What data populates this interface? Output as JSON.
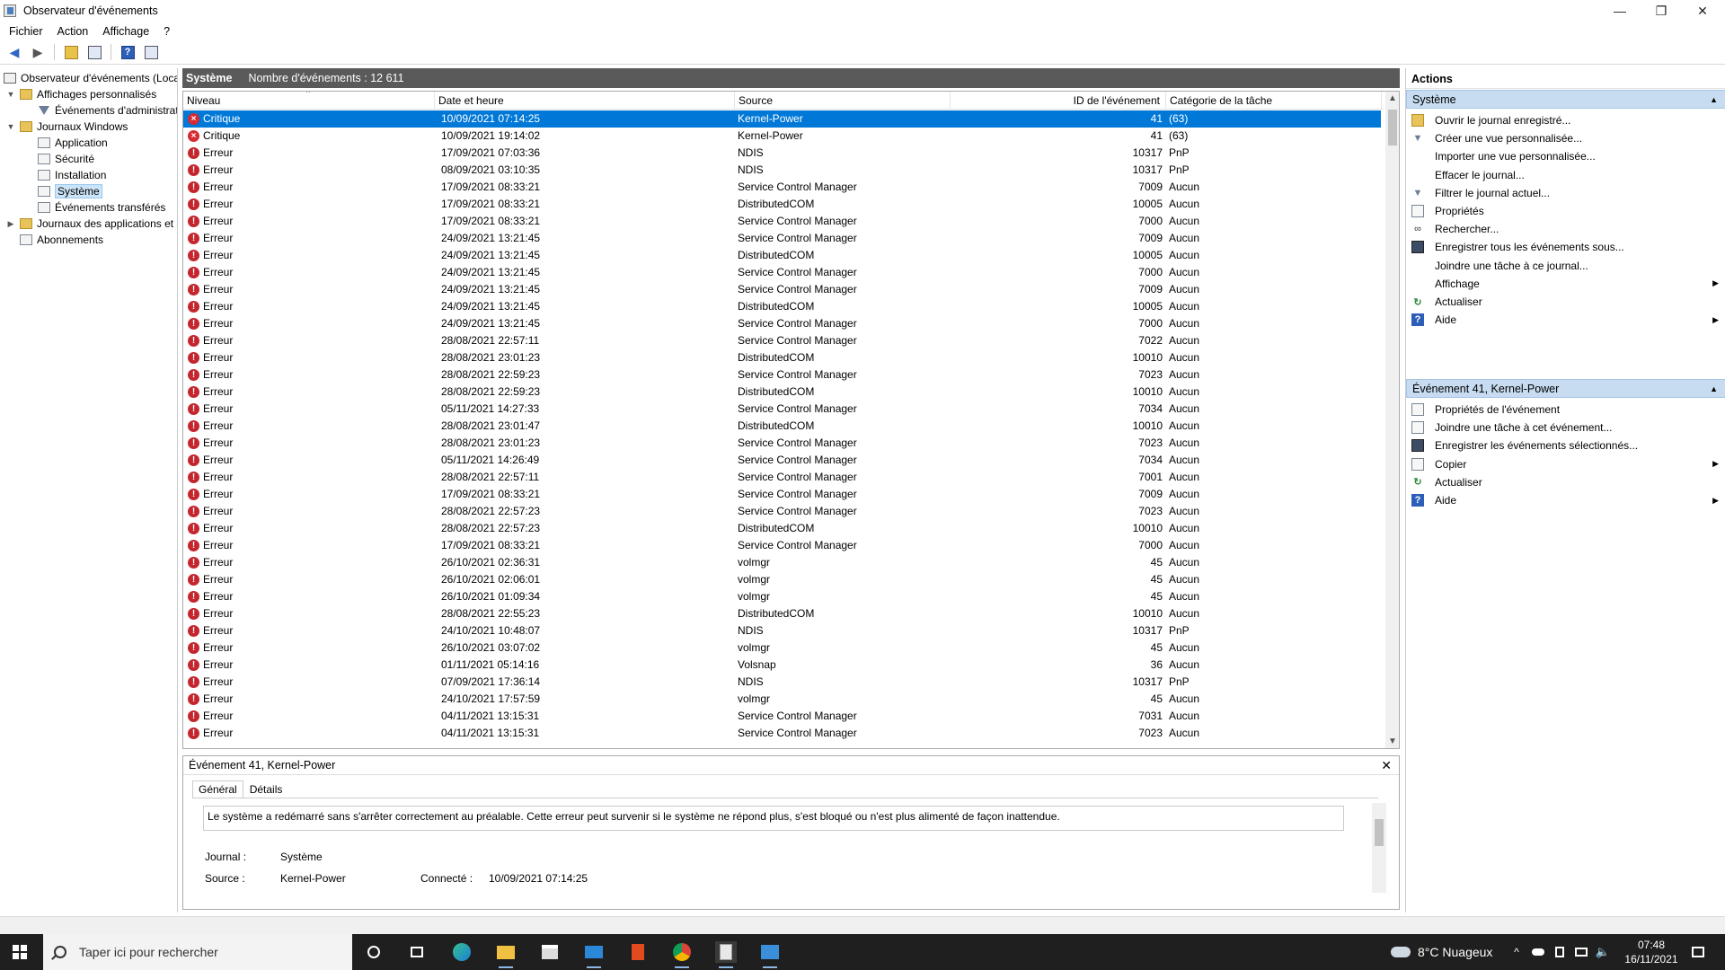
{
  "window": {
    "title": "Observateur d'événements",
    "min": "—",
    "max": "❐",
    "close": "✕"
  },
  "menu": [
    "Fichier",
    "Action",
    "Affichage",
    "?"
  ],
  "tree": {
    "root": "Observateur d'événements (Local)",
    "custom_views": "Affichages personnalisés",
    "admin_events": "Événements d'administration",
    "windows_logs": "Journaux Windows",
    "application": "Application",
    "security": "Sécurité",
    "setup": "Installation",
    "system": "Système",
    "forwarded": "Événements transférés",
    "apps_logs": "Journaux des applications et services",
    "subscriptions": "Abonnements"
  },
  "list_header": {
    "title": "Système",
    "count": "Nombre d'événements : 12 611"
  },
  "columns": [
    "Niveau",
    "Date et heure",
    "Source",
    "ID de l'événement",
    "Catégorie de la tâche"
  ],
  "events": [
    [
      "Critique",
      "10/09/2021 07:14:25",
      "Kernel-Power",
      "41",
      "(63)"
    ],
    [
      "Critique",
      "10/09/2021 19:14:02",
      "Kernel-Power",
      "41",
      "(63)"
    ],
    [
      "Erreur",
      "17/09/2021 07:03:36",
      "NDIS",
      "10317",
      "PnP"
    ],
    [
      "Erreur",
      "08/09/2021 03:10:35",
      "NDIS",
      "10317",
      "PnP"
    ],
    [
      "Erreur",
      "17/09/2021 08:33:21",
      "Service Control Manager",
      "7009",
      "Aucun"
    ],
    [
      "Erreur",
      "17/09/2021 08:33:21",
      "DistributedCOM",
      "10005",
      "Aucun"
    ],
    [
      "Erreur",
      "17/09/2021 08:33:21",
      "Service Control Manager",
      "7000",
      "Aucun"
    ],
    [
      "Erreur",
      "24/09/2021 13:21:45",
      "Service Control Manager",
      "7009",
      "Aucun"
    ],
    [
      "Erreur",
      "24/09/2021 13:21:45",
      "DistributedCOM",
      "10005",
      "Aucun"
    ],
    [
      "Erreur",
      "24/09/2021 13:21:45",
      "Service Control Manager",
      "7000",
      "Aucun"
    ],
    [
      "Erreur",
      "24/09/2021 13:21:45",
      "Service Control Manager",
      "7009",
      "Aucun"
    ],
    [
      "Erreur",
      "24/09/2021 13:21:45",
      "DistributedCOM",
      "10005",
      "Aucun"
    ],
    [
      "Erreur",
      "24/09/2021 13:21:45",
      "Service Control Manager",
      "7000",
      "Aucun"
    ],
    [
      "Erreur",
      "28/08/2021 22:57:11",
      "Service Control Manager",
      "7022",
      "Aucun"
    ],
    [
      "Erreur",
      "28/08/2021 23:01:23",
      "DistributedCOM",
      "10010",
      "Aucun"
    ],
    [
      "Erreur",
      "28/08/2021 22:59:23",
      "Service Control Manager",
      "7023",
      "Aucun"
    ],
    [
      "Erreur",
      "28/08/2021 22:59:23",
      "DistributedCOM",
      "10010",
      "Aucun"
    ],
    [
      "Erreur",
      "05/11/2021 14:27:33",
      "Service Control Manager",
      "7034",
      "Aucun"
    ],
    [
      "Erreur",
      "28/08/2021 23:01:47",
      "DistributedCOM",
      "10010",
      "Aucun"
    ],
    [
      "Erreur",
      "28/08/2021 23:01:23",
      "Service Control Manager",
      "7023",
      "Aucun"
    ],
    [
      "Erreur",
      "05/11/2021 14:26:49",
      "Service Control Manager",
      "7034",
      "Aucun"
    ],
    [
      "Erreur",
      "28/08/2021 22:57:11",
      "Service Control Manager",
      "7001",
      "Aucun"
    ],
    [
      "Erreur",
      "17/09/2021 08:33:21",
      "Service Control Manager",
      "7009",
      "Aucun"
    ],
    [
      "Erreur",
      "28/08/2021 22:57:23",
      "Service Control Manager",
      "7023",
      "Aucun"
    ],
    [
      "Erreur",
      "28/08/2021 22:57:23",
      "DistributedCOM",
      "10010",
      "Aucun"
    ],
    [
      "Erreur",
      "17/09/2021 08:33:21",
      "Service Control Manager",
      "7000",
      "Aucun"
    ],
    [
      "Erreur",
      "26/10/2021 02:36:31",
      "volmgr",
      "45",
      "Aucun"
    ],
    [
      "Erreur",
      "26/10/2021 02:06:01",
      "volmgr",
      "45",
      "Aucun"
    ],
    [
      "Erreur",
      "26/10/2021 01:09:34",
      "volmgr",
      "45",
      "Aucun"
    ],
    [
      "Erreur",
      "28/08/2021 22:55:23",
      "DistributedCOM",
      "10010",
      "Aucun"
    ],
    [
      "Erreur",
      "24/10/2021 10:48:07",
      "NDIS",
      "10317",
      "PnP"
    ],
    [
      "Erreur",
      "26/10/2021 03:07:02",
      "volmgr",
      "45",
      "Aucun"
    ],
    [
      "Erreur",
      "01/11/2021 05:14:16",
      "Volsnap",
      "36",
      "Aucun"
    ],
    [
      "Erreur",
      "07/09/2021 17:36:14",
      "NDIS",
      "10317",
      "PnP"
    ],
    [
      "Erreur",
      "24/10/2021 17:57:59",
      "volmgr",
      "45",
      "Aucun"
    ],
    [
      "Erreur",
      "04/11/2021 13:15:31",
      "Service Control Manager",
      "7031",
      "Aucun"
    ],
    [
      "Erreur",
      "04/11/2021 13:15:31",
      "Service Control Manager",
      "7023",
      "Aucun"
    ]
  ],
  "detail": {
    "title": "Événement 41, Kernel-Power",
    "close": "✕",
    "tabs": [
      "Général",
      "Détails"
    ],
    "message": "Le système a redémarré sans s'arrêter correctement au préalable. Cette erreur peut survenir si le système ne répond plus, s'est bloqué ou n'est plus alimenté de façon inattendue.",
    "journal_label": "Journal :",
    "journal_value": "Système",
    "source_label": "Source :",
    "source_value": "Kernel-Power",
    "connected_label": "Connecté :",
    "connected_value": "10/09/2021 07:14:25"
  },
  "actions": {
    "title": "Actions",
    "section1": "Système",
    "items1": [
      {
        "label": "Ouvrir le journal enregistré...",
        "icon": "folder-icon"
      },
      {
        "label": "Créer une vue personnalisée...",
        "icon": "filter-icon"
      },
      {
        "label": "Importer une vue personnalisée...",
        "icon": ""
      },
      {
        "label": "Effacer le journal...",
        "icon": ""
      },
      {
        "label": "Filtrer le journal actuel...",
        "icon": "filter-icon"
      },
      {
        "label": "Propriétés",
        "icon": "properties-icon"
      },
      {
        "label": "Rechercher...",
        "icon": "binoculars-icon"
      },
      {
        "label": "Enregistrer tous les événements sous...",
        "icon": "save-icon"
      },
      {
        "label": "Joindre une tâche à ce journal...",
        "icon": ""
      },
      {
        "label": "Affichage",
        "icon": "",
        "sub": true
      },
      {
        "label": "Actualiser",
        "icon": "refresh-icon"
      },
      {
        "label": "Aide",
        "icon": "help-icon",
        "sub": true
      }
    ],
    "section2": "Événement 41, Kernel-Power",
    "items2": [
      {
        "label": "Propriétés de l'événement",
        "icon": "properties-icon"
      },
      {
        "label": "Joindre une tâche à cet événement...",
        "icon": "task-icon"
      },
      {
        "label": "Enregistrer les événements sélectionnés...",
        "icon": "save-icon"
      },
      {
        "label": "Copier",
        "icon": "copy-icon",
        "sub": true
      },
      {
        "label": "Actualiser",
        "icon": "refresh-icon"
      },
      {
        "label": "Aide",
        "icon": "help-icon",
        "sub": true
      }
    ]
  },
  "taskbar": {
    "search_placeholder": "Taper ici pour rechercher",
    "weather": "8°C  Nuageux",
    "time": "07:48",
    "date": "16/11/2021"
  },
  "colors": {
    "selection": "#0078d7",
    "error": "#c4262e",
    "section_bg": "#c7dcf0",
    "taskbar": "#1f1f1f"
  }
}
